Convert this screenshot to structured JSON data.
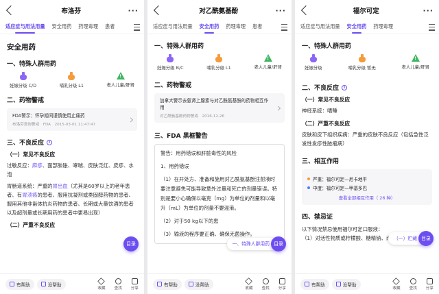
{
  "screens": [
    {
      "title": "布洛芬",
      "tabs": [
        "适应症与用法用量",
        "安全用药",
        "药理毒理",
        "患者"
      ],
      "active_tab": 0,
      "section_title": "安全用药",
      "special_title": "一、特殊人群用药",
      "special": [
        {
          "icon": "pregnancy-icon",
          "label": "妊娠分级 C/D"
        },
        {
          "icon": "lactation-icon",
          "label": "哺乳分级 L1"
        },
        {
          "icon": "elderly-child-warning-icon",
          "label": "老人儿童/肝肾"
        }
      ],
      "alert_title": "二、药物警戒",
      "alert_card": {
        "title": "FDA警示：怀孕期间谨慎使用止痛药",
        "meta": "布洛芬咨询警戒　FDA　2015-03-01 11:47:47"
      },
      "adverse_title": "三、不良反应",
      "common_title": "（一）常见不良反应",
      "common_prefix": "过敏反应：",
      "common_link": "麻疹",
      "common_rest": "、面部肿胀、哮喘、皮肤泛红、皮疹、水泡",
      "gi_prefix": "胃肠道系统：严重的",
      "gi_link1": "胃出血",
      "gi_mid": "（尤其是60岁以上的老年患者、有",
      "gi_link2": "胃溃疡",
      "gi_rest": "的患者、服用抗凝剂或类固醇药物的患者、服用其他非甾体抗炎药物的患者、长期或大量饮酒的患者以及超剂量或长期用药的患者中更易出现）",
      "serious_title": "（二）严重不良反应",
      "toc": "目录"
    },
    {
      "title": "对乙酰氨基酚",
      "tabs": [
        "适应症与用法用量",
        "安全用药",
        "药理毒理",
        "患者"
      ],
      "active_tab": 1,
      "special_title": "一、特殊人群用药",
      "special": [
        {
          "icon": "pregnancy-icon",
          "label": "妊娠分级 B/C"
        },
        {
          "icon": "lactation-icon",
          "label": "哺乳分级 L1"
        },
        {
          "icon": "elderly-child-warning-icon",
          "label": "老人儿童/肝肾"
        }
      ],
      "alert_title": "二、药物警戒",
      "alert_card": {
        "title": "加拿大警示去氨肾上腺素与对乙酰氨基酚的药物相互作用",
        "meta": "对乙酰氨基酚药物警戒　2016-12-26"
      },
      "fda_title": "三、FDA 黑框警告",
      "fda_paragraphs": [
        "警告：用药错误和肝脏毒性的风险",
        "1、用药错误",
        "（1）在开处方、准备和施用对乙酰氨基酚注射液时要注意避免可能导致意外过量和死亡的剂量错误。特别是要小心确保以毫克（mg）为单位的剂量和以毫升（mL）为单位的剂量不要混淆。",
        "（2）对于50 kg以下的患",
        "（3）输液的程序要正确、确保无菌操作。"
      ],
      "toc_pill": "一、特殊人群用药",
      "toc": "目录"
    },
    {
      "title": "福尔可定",
      "tabs": [
        "适应症与用法用量",
        "安全用药",
        "药理毒理"
      ],
      "active_tab": 1,
      "special_title": "一、特殊人群用药",
      "special": [
        {
          "icon": "pregnancy-icon",
          "label": "妊娠分级"
        },
        {
          "icon": "lactation-icon",
          "label": "哺乳分级 暂无"
        },
        {
          "icon": "elderly-child-warning-icon",
          "label": "老人儿童/肝肾"
        }
      ],
      "adverse_title": "二、不良反应",
      "common_title": "（一）常见不良反应",
      "common_text": "神经系统：嗜睡",
      "serious_title": "（二）严重不良反应",
      "serious_text": "皮肤和皮下组织疾病：严重的皮肤不良反应（包括急性泛发性发疹性脓疱病）",
      "interaction_title": "三、相互作用",
      "interactions": [
        {
          "level": "严重",
          "text": "严重：福尔可定—尼卡地平"
        },
        {
          "level": "中度",
          "text": "中度：福尔可定—甲基多巴"
        }
      ],
      "interaction_link": "查看全部相互作用（ 26 种）",
      "contra_title": "四、禁忌证",
      "contra_text1": "以下情况禁忌使用福尔可定口服液：",
      "contra_text2": "（1）对活性物质或柠檬酸、糖精钠、丙二醇、苯甲",
      "toc_pill": "（一）贮藏",
      "toc": "目录"
    }
  ],
  "bottom_bar": {
    "helpful": "有帮助",
    "not_helpful": "没帮助",
    "favorite": "收藏",
    "search": "查找",
    "share": "分享"
  },
  "colors": {
    "accent": "#6c4ef0",
    "pregnancy": "#8b67f5",
    "lactation": "#f59b3b",
    "warning": "#3fb561"
  }
}
